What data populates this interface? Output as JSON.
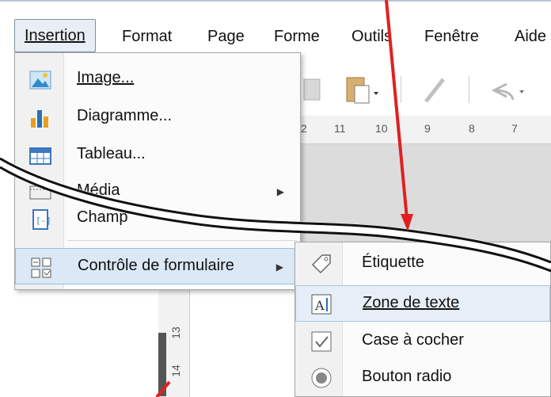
{
  "menubar": {
    "items": [
      {
        "label": "Insertion",
        "active": true
      },
      {
        "label": "Format"
      },
      {
        "label": "Page"
      },
      {
        "label": "Forme"
      },
      {
        "label": "Outils"
      },
      {
        "label": "Fenêtre"
      },
      {
        "label": "Aide"
      }
    ]
  },
  "insert_menu": {
    "items": [
      {
        "label": "Image...",
        "icon": "image-icon"
      },
      {
        "label": "Diagramme...",
        "icon": "chart-icon"
      },
      {
        "label": "Tableau...",
        "icon": "table-icon"
      },
      {
        "label": "Média",
        "icon": "media-icon",
        "has_submenu": true
      },
      {
        "label": "Champ",
        "icon": "field-icon"
      },
      {
        "label": "Contrôle de formulaire",
        "icon": "form-control-icon",
        "has_submenu": true,
        "highlighted": true
      }
    ]
  },
  "form_control_submenu": {
    "items": [
      {
        "label": "Étiquette",
        "icon": "label-tag-icon"
      },
      {
        "label": "Zone de texte",
        "icon": "text-box-icon",
        "highlighted": true
      },
      {
        "label": "Case à cocher",
        "icon": "checkbox-icon"
      },
      {
        "label": "Bouton radio",
        "icon": "radio-button-icon"
      }
    ]
  },
  "ruler": {
    "horizontal_ticks": [
      "2",
      "11",
      "10",
      "9",
      "8",
      "7"
    ],
    "vertical_ticks": [
      "13",
      "14"
    ]
  },
  "colors": {
    "arrow": "#e02020",
    "highlight": "#dbe8f6",
    "menu_bg": "#fbfbfb"
  }
}
